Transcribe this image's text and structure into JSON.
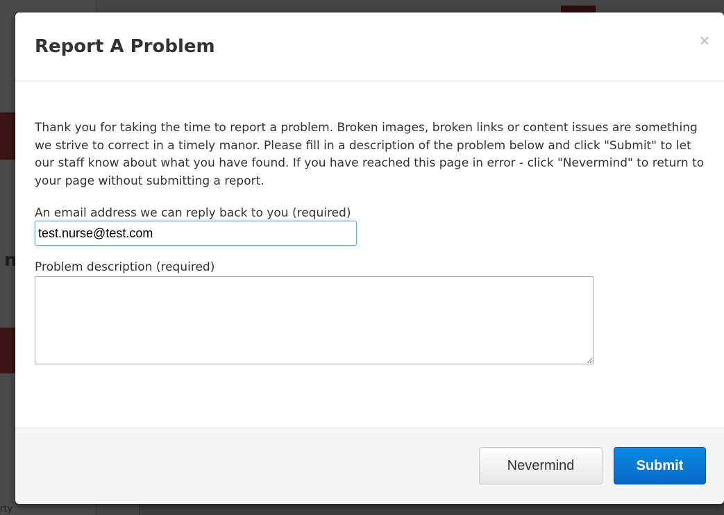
{
  "modal": {
    "title": "Report A Problem",
    "close_symbol": "×",
    "intro": "Thank you for taking the time to report a problem. Broken images, broken links or content issues are something we strive to correct in a timely manor. Please fill in a description of the problem below and click \"Submit\" to let our staff know about what you have found. If you have reached this page in error - click \"Nevermind\" to return to your page without submitting a report.",
    "email": {
      "label": "An email address we can reply back to you (required)",
      "value": "test.nurse@test.com"
    },
    "description": {
      "label": "Problem description (required)",
      "value": ""
    },
    "buttons": {
      "nevermind": "Nevermind",
      "submit": "Submit"
    }
  },
  "background": {
    "fragments": [
      "n",
      "rty"
    ]
  },
  "colors": {
    "primary_button": "#0569c5",
    "overlay": "#454545"
  }
}
